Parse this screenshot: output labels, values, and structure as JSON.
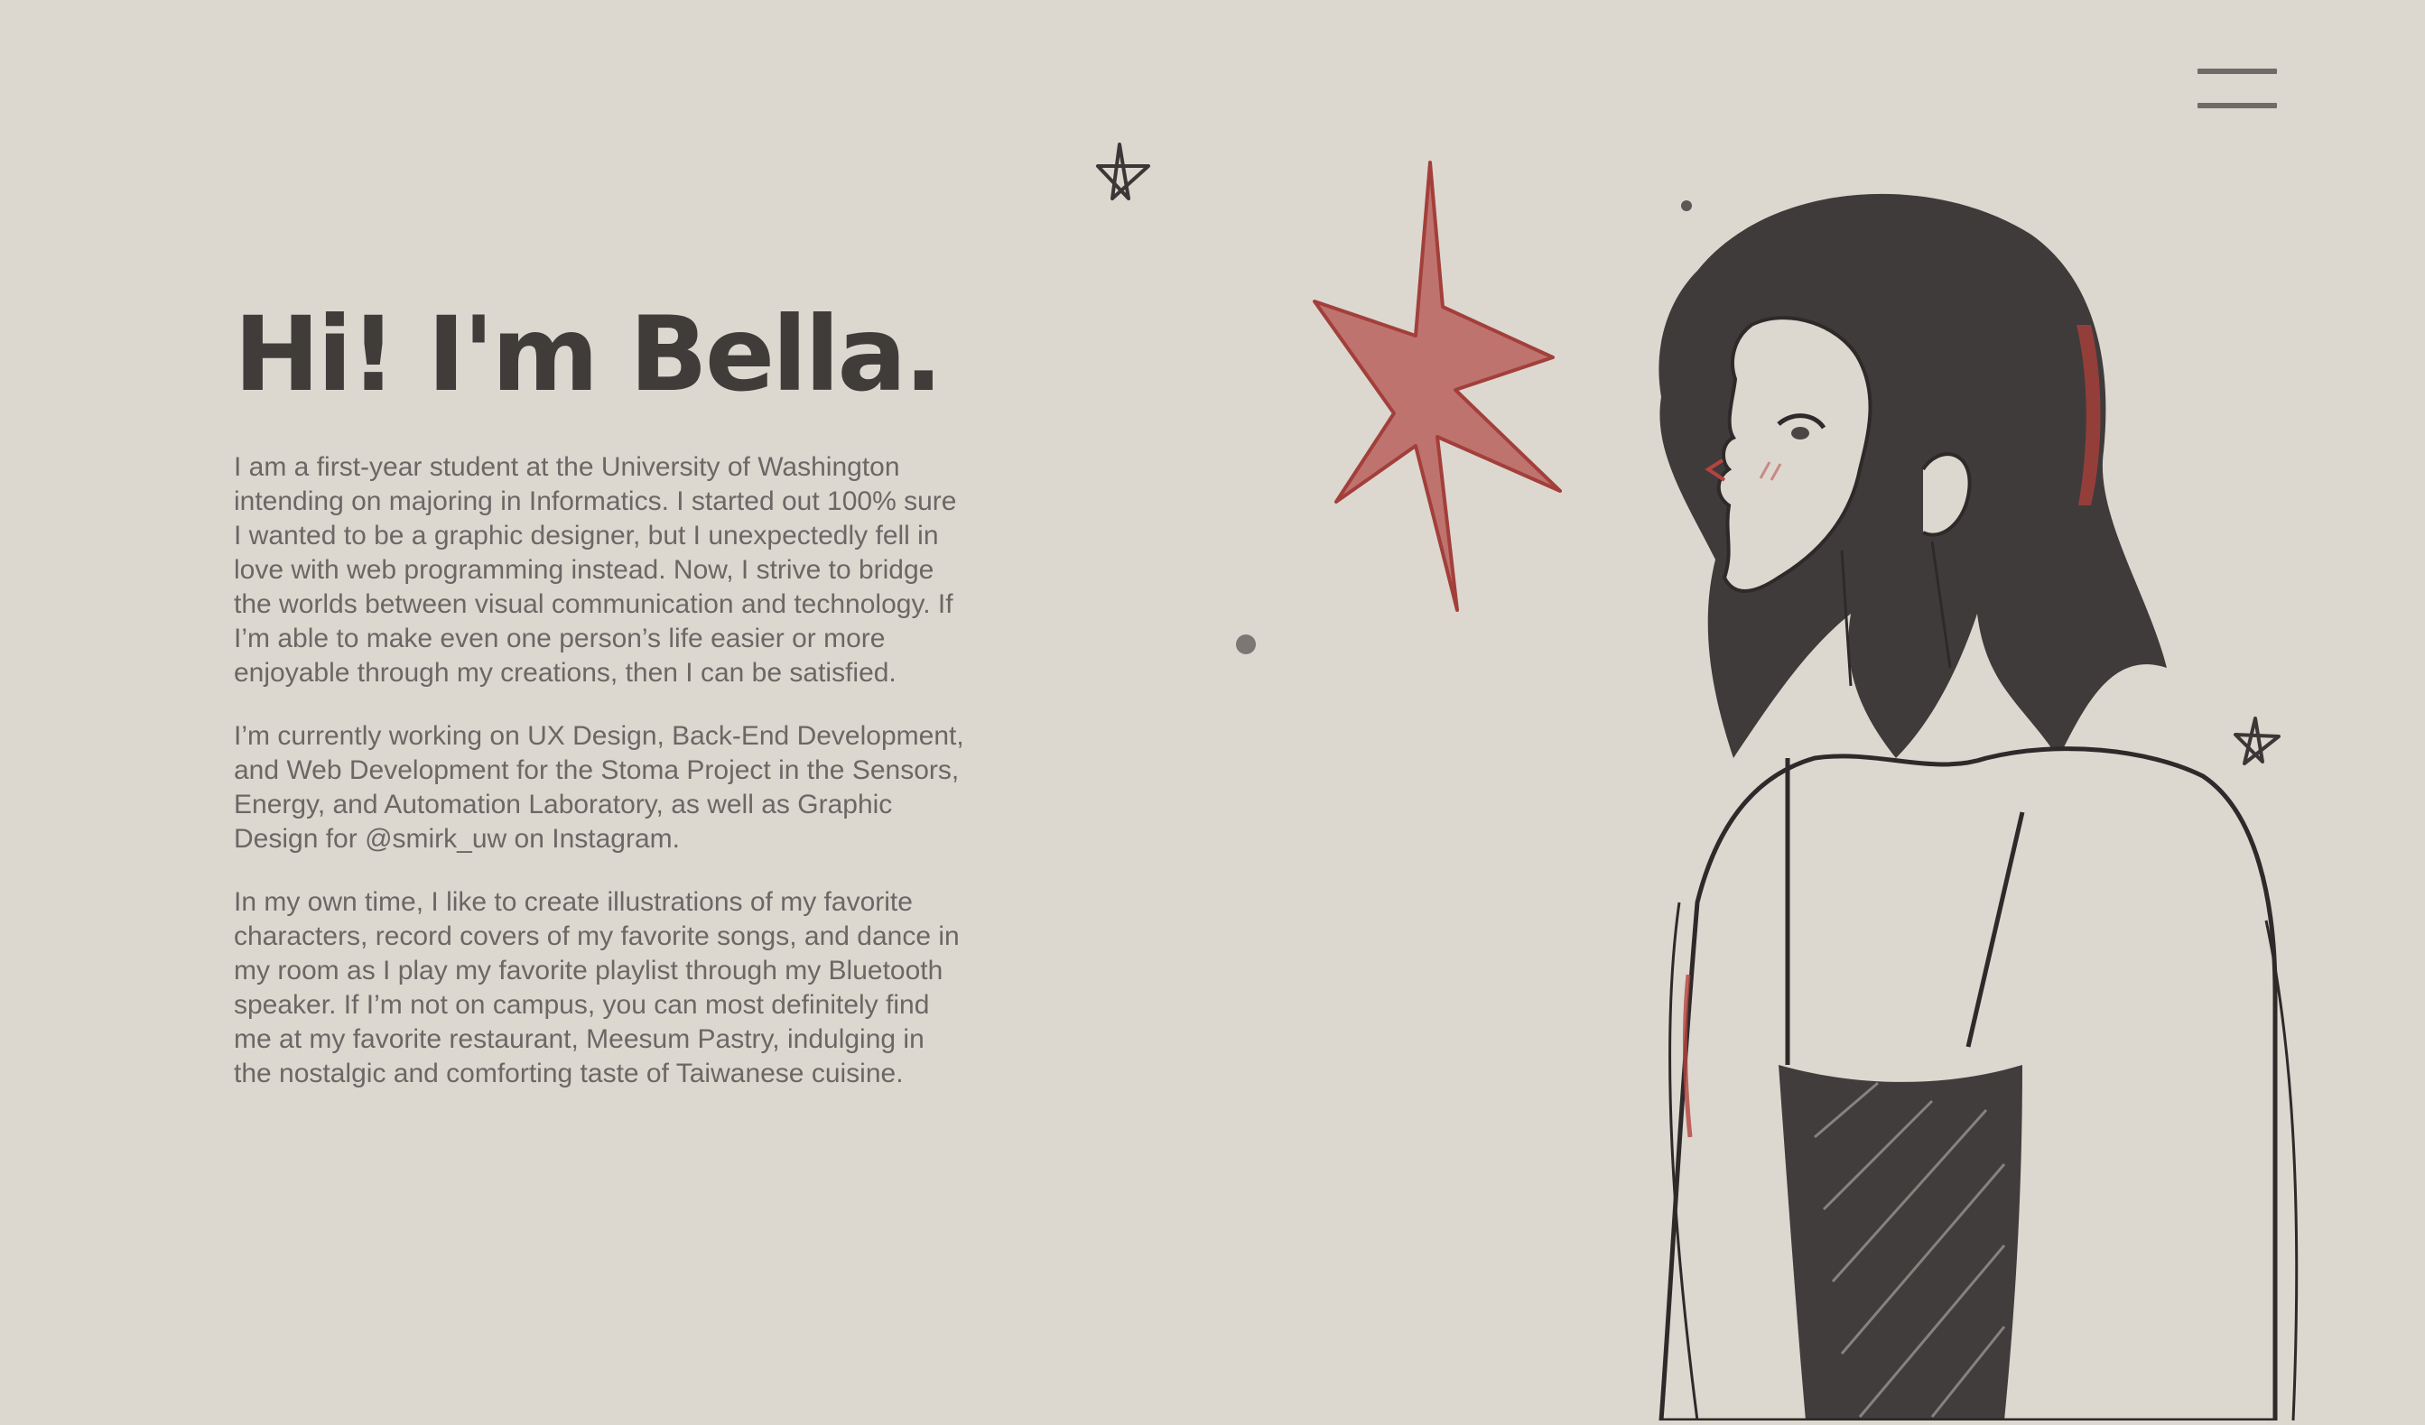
{
  "header": {
    "menu_icon": "hamburger-menu-icon"
  },
  "intro": {
    "title": "Hi! I'm Bella.",
    "paragraphs": [
      "I am a first-year student at the University of Washington intending on majoring in Informatics. I started out 100% sure I wanted to be a graphic designer, but I unexpectedly fell in love with web programming instead. Now, I strive to bridge the worlds between visual communication and technology. If I’m able to make even one person’s life easier or more enjoyable through my creations, then I can be satisfied.",
      "I’m currently working on UX Design, Back-End Development, and Web Development for the Stoma Project in the Sensors, Energy, and Automation Laboratory, as well as Graphic Design for @smirk_uw on Instagram.",
      "In my own time, I like to create illustrations of my favorite characters, record covers of my favorite songs, and dance in my room as I play my favorite playlist through my Bluetooth speaker. If I’m not on campus, you can most definitely find me at my favorite restaurant, Meesum Pastry, indulging in the nostalgic and comforting taste of Taiwanese cuisine."
    ]
  },
  "colors": {
    "background": "#dcd8d0",
    "heading": "#403c3a",
    "body_text": "#6b6764",
    "accent_red": "#b5443f",
    "sketch": "#2b2727"
  },
  "illustration": {
    "icon": "girl-sketch-illustration",
    "decorations": [
      "star-doodle-icon",
      "red-sparkle-icon",
      "dot-icon"
    ]
  }
}
